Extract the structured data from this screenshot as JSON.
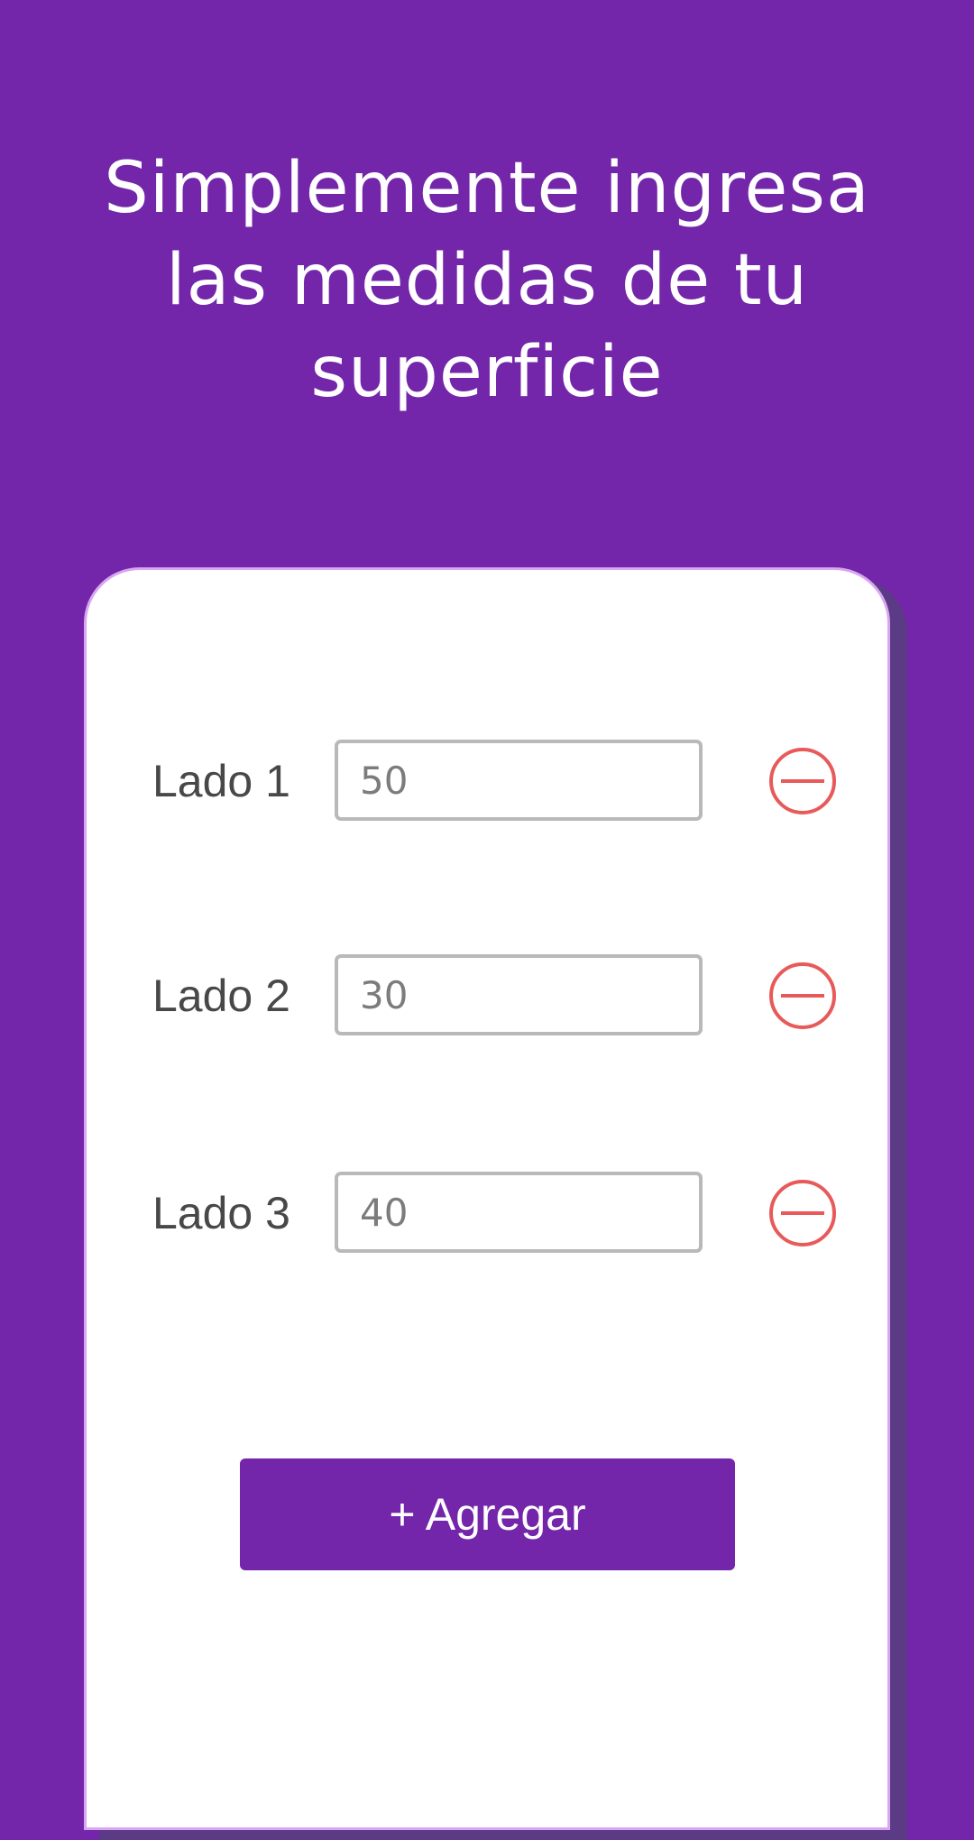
{
  "header": {
    "title": "Simplemente ingresa las medidas de tu superficie"
  },
  "sides": [
    {
      "label": "Lado 1",
      "value": "50"
    },
    {
      "label": "Lado 2",
      "value": "30"
    },
    {
      "label": "Lado 3",
      "value": "40"
    }
  ],
  "actions": {
    "add_label": "+ Agregar"
  },
  "icons": {
    "remove": "minus-circle-icon"
  },
  "colors": {
    "background": "#7326a9",
    "card": "#ffffff",
    "card_border": "#d9a6f2",
    "remove_icon": "#e85a5a",
    "label_text": "#484848",
    "input_text": "#7c7c7c"
  }
}
